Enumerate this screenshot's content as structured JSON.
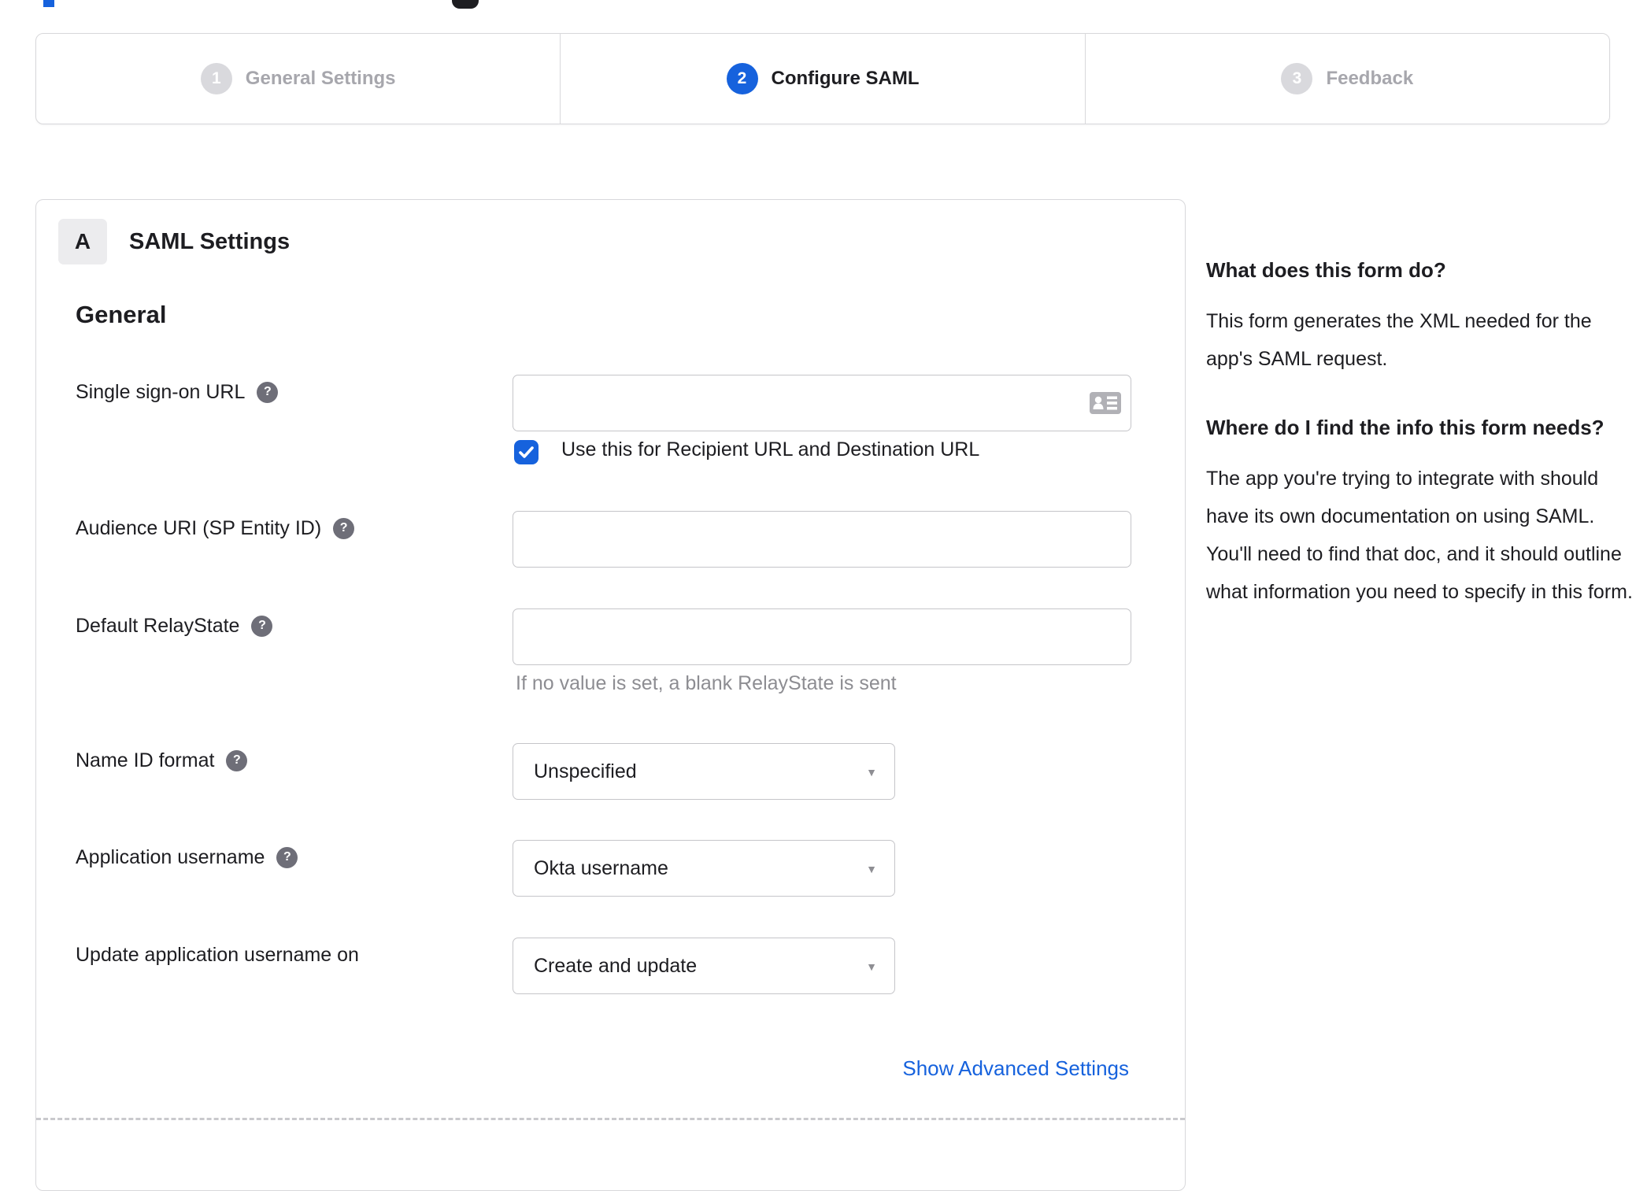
{
  "stepper": {
    "steps": [
      {
        "number": "1",
        "label": "General Settings",
        "state": "inactive"
      },
      {
        "number": "2",
        "label": "Configure SAML",
        "state": "active"
      },
      {
        "number": "3",
        "label": "Feedback",
        "state": "inactive"
      }
    ]
  },
  "panel": {
    "badge": "A",
    "title": "SAML Settings",
    "group_heading": "General",
    "fields": [
      {
        "label": "Single sign-on URL",
        "type": "text",
        "value": "",
        "placeholder": "",
        "checkbox_label": "Use this for Recipient URL and Destination URL",
        "checkbox_checked": true
      },
      {
        "label": "Audience URI (SP Entity ID)",
        "type": "text",
        "value": "",
        "placeholder": ""
      },
      {
        "label": "Default RelayState",
        "type": "text",
        "value": "",
        "placeholder": "",
        "helper": "If no value is set, a blank RelayState is sent"
      },
      {
        "label": "Name ID format",
        "type": "select",
        "value": "Unspecified"
      },
      {
        "label": "Application username",
        "type": "select",
        "value": "Okta username"
      },
      {
        "label": "Update application username on",
        "type": "select",
        "value": "Create and update"
      }
    ],
    "advanced_link": "Show Advanced Settings"
  },
  "sidebar": {
    "sections": [
      {
        "heading": "What does this form do?",
        "body": "This form generates the XML needed for the app's SAML request."
      },
      {
        "heading": "Where do I find the info this form needs?",
        "body": "The app you're trying to integrate with should have its own documentation on using SAML. You'll need to find that doc, and it should outline what information you need to specify in this form."
      }
    ]
  },
  "icons": {
    "help_glyph": "?",
    "dropdown_glyph": "▼"
  },
  "colors": {
    "accent_blue": "#1662dd",
    "text_dark": "#1d1d21",
    "inactive_gray": "#a7a7ad",
    "helper_gray": "#8d8d92"
  }
}
